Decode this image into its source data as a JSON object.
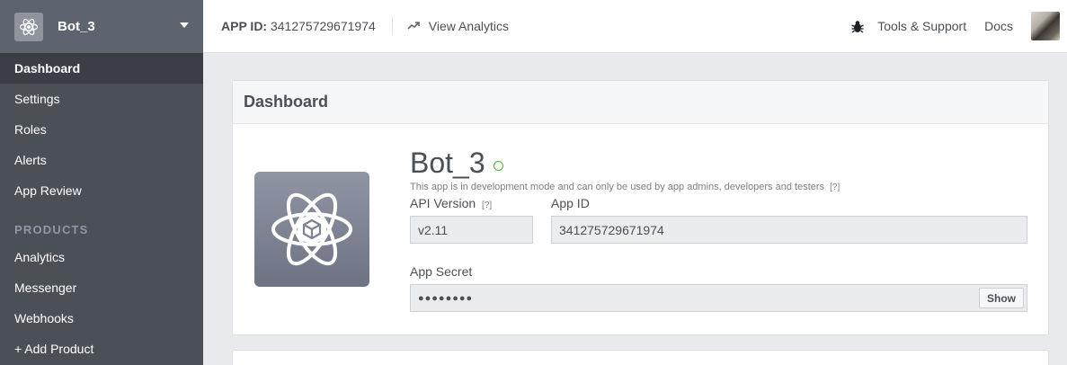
{
  "sidebar": {
    "app_name": "Bot_3",
    "items": [
      {
        "label": "Dashboard"
      },
      {
        "label": "Settings"
      },
      {
        "label": "Roles"
      },
      {
        "label": "Alerts"
      },
      {
        "label": "App Review"
      }
    ],
    "section_products": "PRODUCTS",
    "product_items": [
      {
        "label": "Analytics"
      },
      {
        "label": "Messenger"
      },
      {
        "label": "Webhooks"
      },
      {
        "label": "+ Add Product"
      }
    ]
  },
  "topbar": {
    "app_id_label": "APP ID:",
    "app_id_value": "341275729671974",
    "analytics_label": "View Analytics",
    "tools_label": "Tools & Support",
    "docs_label": "Docs"
  },
  "dashboard": {
    "header": "Dashboard",
    "app_title": "Bot_3",
    "dev_note": "This app is in development mode and can only be used by app admins, developers and testers",
    "help_mark": "[?]",
    "api_version_label": "API Version",
    "api_version_value": "v2.11",
    "app_id_label": "App ID",
    "app_id_value": "341275729671974",
    "app_secret_label": "App Secret",
    "app_secret_value": "●●●●●●●●",
    "show_button": "Show"
  },
  "colors": {
    "sidebar_bg": "#4b4f56",
    "status_green": "#42b72a"
  }
}
